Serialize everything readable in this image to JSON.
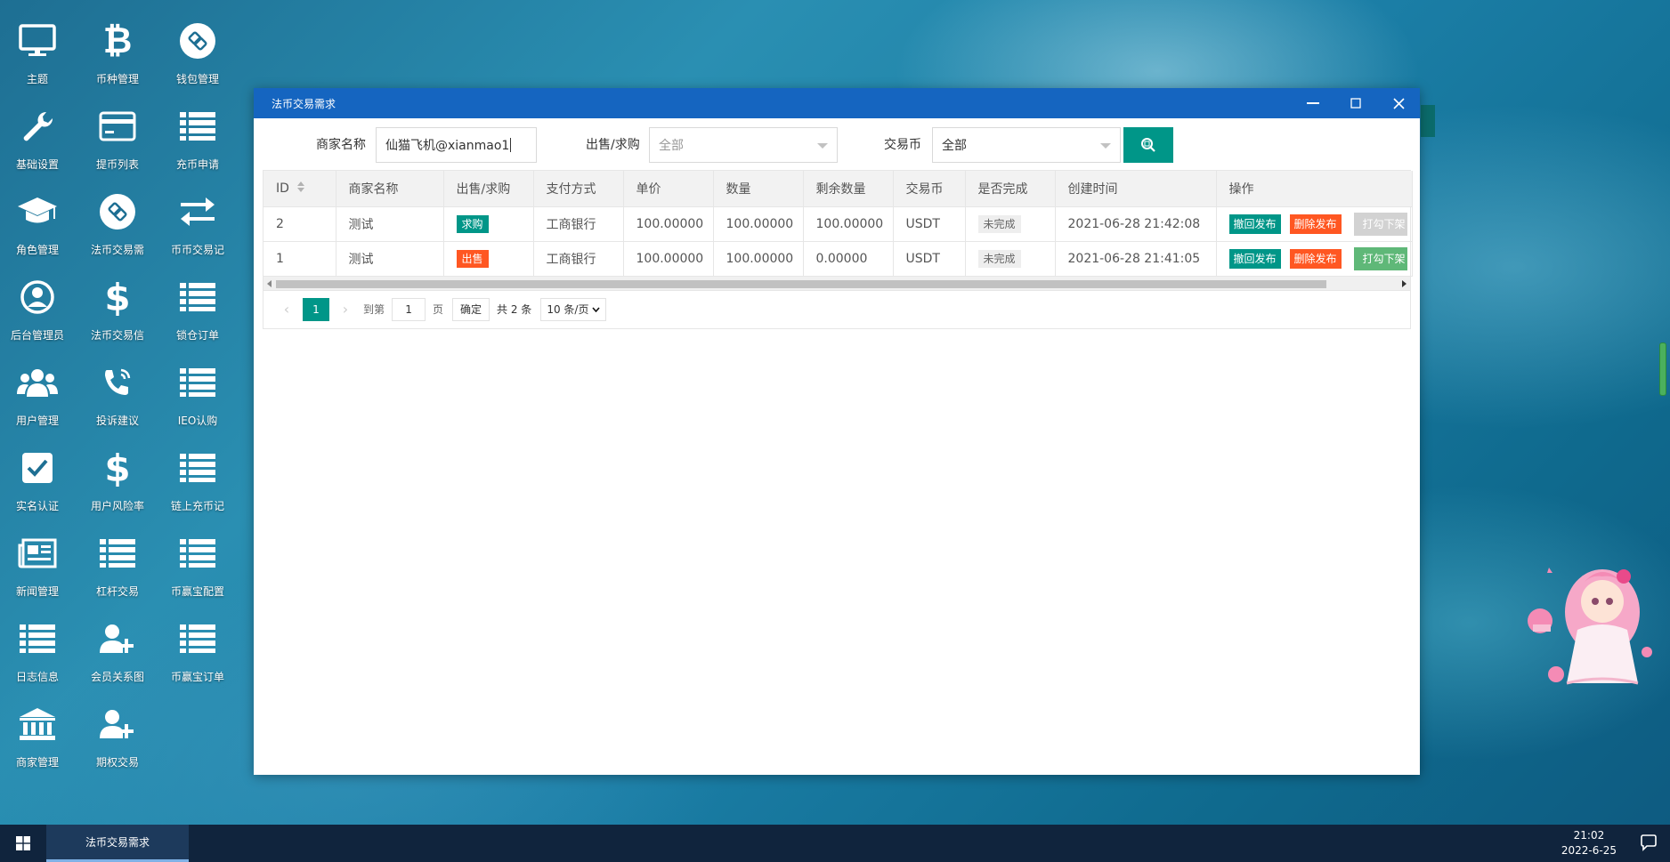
{
  "desktop": {
    "icons": [
      {
        "label": "主题",
        "icon": "monitor-icon"
      },
      {
        "label": "币种管理",
        "icon": "bitcoin-icon"
      },
      {
        "label": "钱包管理",
        "icon": "wallet-link-icon"
      },
      {
        "label": "基础设置",
        "icon": "wrench-icon"
      },
      {
        "label": "提币列表",
        "icon": "credit-card-icon"
      },
      {
        "label": "充币申请",
        "icon": "list-icon"
      },
      {
        "label": "角色管理",
        "icon": "graduation-cap-icon"
      },
      {
        "label": "法币交易需",
        "icon": "link-icon"
      },
      {
        "label": "币币交易记",
        "icon": "exchange-arrows-icon"
      },
      {
        "label": "后台管理员",
        "icon": "user-circle-icon"
      },
      {
        "label": "法币交易信",
        "icon": "dollar-icon"
      },
      {
        "label": "锁仓订单",
        "icon": "list-icon"
      },
      {
        "label": "用户管理",
        "icon": "users-icon"
      },
      {
        "label": "投诉建议",
        "icon": "phone-icon"
      },
      {
        "label": "IEO认购",
        "icon": "list-icon"
      },
      {
        "label": "实名认证",
        "icon": "check-square-icon"
      },
      {
        "label": "用户风险率",
        "icon": "dollar-icon"
      },
      {
        "label": "链上充币记",
        "icon": "list-icon"
      },
      {
        "label": "新闻管理",
        "icon": "newspaper-icon"
      },
      {
        "label": "杠杆交易",
        "icon": "list-icon"
      },
      {
        "label": "币赢宝配置",
        "icon": "list-icon"
      },
      {
        "label": "日志信息",
        "icon": "list-icon"
      },
      {
        "label": "会员关系图",
        "icon": "user-add-icon"
      },
      {
        "label": "币赢宝订单",
        "icon": "list-icon"
      },
      {
        "label": "商家管理",
        "icon": "bank-icon"
      },
      {
        "label": "期权交易",
        "icon": "user-add-icon"
      }
    ]
  },
  "window": {
    "title": "法币交易需求",
    "filters": {
      "merchant_label": "商家名称",
      "merchant_value": "仙猫飞机@xianmao1",
      "type_label": "出售/求购",
      "type_value": "全部",
      "coin_label": "交易币",
      "coin_value": "全部"
    },
    "table": {
      "columns": [
        "ID",
        "商家名称",
        "出售/求购",
        "支付方式",
        "单价",
        "数量",
        "剩余数量",
        "交易币",
        "是否完成",
        "创建时间",
        "操作"
      ],
      "rows": [
        {
          "id": "2",
          "merchant": "测试",
          "type": "求购",
          "type_kind": "buy",
          "pay": "工商银行",
          "price": "100.00000",
          "qty": "100.00000",
          "remain": "100.00000",
          "coin": "USDT",
          "done": "未完成",
          "created": "2021-06-28 21:42:08",
          "act1": "撤回发布",
          "act2": "删除发布",
          "act3": "打勾下架",
          "act3_state": "disabled"
        },
        {
          "id": "1",
          "merchant": "测试",
          "type": "出售",
          "type_kind": "sell",
          "pay": "工商银行",
          "price": "100.00000",
          "qty": "100.00000",
          "remain": "0.00000",
          "coin": "USDT",
          "done": "未完成",
          "created": "2021-06-28 21:41:05",
          "act1": "撤回发布",
          "act2": "删除发布",
          "act3": "打勾下架",
          "act3_state": "enabled"
        }
      ]
    },
    "pager": {
      "current": "1",
      "goto_label": "到第",
      "goto_value": "1",
      "page_label": "页",
      "confirm": "确定",
      "total": "共 2 条",
      "size": "10 条/页"
    }
  },
  "taskbar": {
    "task_label": "法币交易需求",
    "time": "21:02",
    "date": "2022-6-25"
  },
  "colors": {
    "titlebar": "#1565c0",
    "accent": "#009688",
    "danger": "#ff5722",
    "taskbar": "#10243d"
  }
}
